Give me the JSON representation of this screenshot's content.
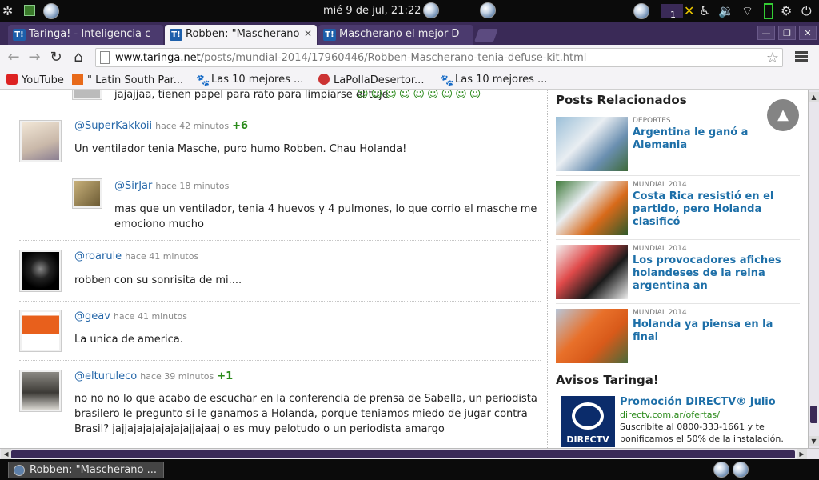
{
  "system": {
    "clock": "mié  9 de jul, 21:22",
    "notification_count": "1"
  },
  "tabs": [
    {
      "label": "Taringa! - Inteligencia c"
    },
    {
      "label": "Robben: \"Mascherano"
    },
    {
      "label": "Mascherano el mejor D"
    }
  ],
  "window_controls": {
    "minimize": "—",
    "maximize": "❐",
    "close": "✕"
  },
  "toolbar": {
    "url_host": "www.taringa.net",
    "url_path": "/posts/mundial-2014/17960446/Robben-Mascherano-tenia-defuse-kit.html"
  },
  "bookmarks": [
    {
      "label": "YouTube"
    },
    {
      "label": "\" Latin South Par..."
    },
    {
      "label": "Las 10 mejores ..."
    },
    {
      "label": "LaPollaDesertor..."
    },
    {
      "label": "Las 10 mejores ..."
    }
  ],
  "comments": [
    {
      "text": "jajajjaa, tienen papel para rato para limpiarse el tuje"
    },
    {
      "user": "@SuperKakkoii",
      "time": "hace 42 minutos",
      "votes": "+6",
      "text": "Un ventilador tenia Masche, puro humo Robben. Chau Holanda!"
    },
    {
      "user": "@SirJar",
      "time": "hace 18 minutos",
      "text": "mas que un ventilador, tenia 4 huevos y 4 pulmones, lo que corrio el masche me emociono mucho"
    },
    {
      "user": "@roarule",
      "time": "hace 41 minutos",
      "text": "robben con su sonrisita de mi...."
    },
    {
      "user": "@geav",
      "time": "hace 41 minutos",
      "text": "La unica de america."
    },
    {
      "user": "@elturuleco",
      "time": "hace 39 minutos",
      "votes": "+1",
      "text": "no no no lo que acabo de escuchar en la conferencia de prensa de Sabella, un periodista brasilero le pregunto si le ganamos a Holanda, porque teniamos miedo de jugar contra Brasil? jajjajajajajajajajjajaaj o es muy pelotudo o un periodista amargo"
    }
  ],
  "sidebar": {
    "related_title": "Posts Relacionados",
    "related": [
      {
        "category": "DEPORTES",
        "title": "Argentina le ganó a Alemania"
      },
      {
        "category": "MUNDIAL 2014",
        "title": "Costa Rica resistió en el partido, pero Holanda clasificó"
      },
      {
        "category": "MUNDIAL 2014",
        "title": "Los provocadores afiches holandeses de la reina argentina an"
      },
      {
        "category": "MUNDIAL 2014",
        "title": "Holanda ya piensa en la final"
      }
    ],
    "ads_title": "Avisos Taringa!",
    "ad": {
      "logo_text": "DIRECTV",
      "title": "Promoción DIRECTV® Julio",
      "url": "directv.com.ar/ofertas/",
      "desc": "Suscribite al 0800-333-1661 y te bonificamos el 50% de la instalación."
    }
  },
  "taskbar": {
    "item_label": "Robben: \"Mascherano ..."
  },
  "colors": {
    "tab_strip": "#3a2a57",
    "link": "#1d6fa8",
    "user": "#2466a8",
    "votes": "#2a8a1a"
  }
}
